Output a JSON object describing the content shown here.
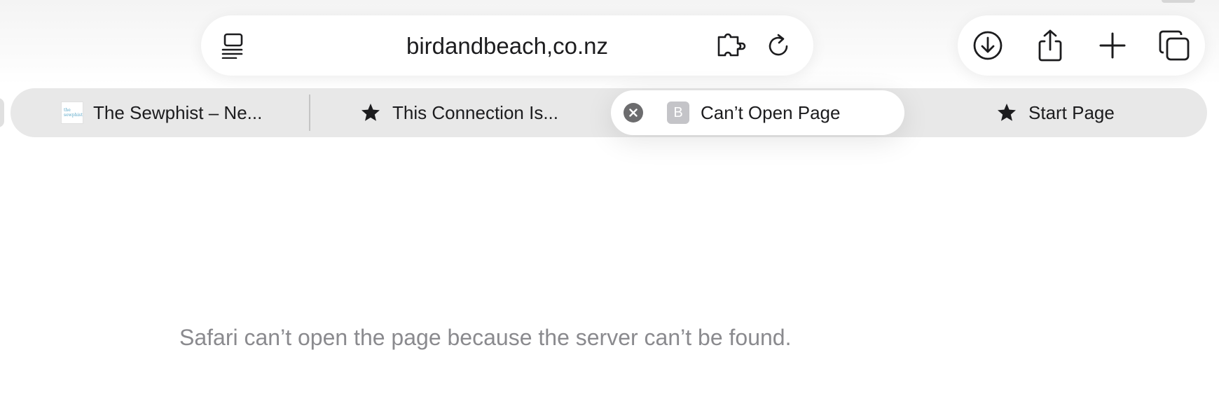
{
  "address_bar": {
    "url": "birdandbeach,co.nz",
    "icons": {
      "reader": "reader-sidebar-icon",
      "extensions": "extension-puzzle-icon",
      "reload": "reload-icon"
    }
  },
  "toolbar": {
    "icons": [
      "download-icon",
      "share-icon",
      "new-tab-plus-icon",
      "tab-overview-icon"
    ]
  },
  "tabs": [
    {
      "title": "The Sewphist – Ne...",
      "favicon": "the sewphist",
      "favicon_line1": "the",
      "favicon_line2": "sewphist",
      "active": false
    },
    {
      "title": "This Connection Is...",
      "favicon": "star-icon",
      "active": false
    },
    {
      "title": "Can’t Open Page",
      "favicon": "B",
      "active": true
    },
    {
      "title": "Start Page",
      "favicon": "star-icon",
      "active": false
    }
  ],
  "error": {
    "message": "Safari can’t open the page because the server can’t be found."
  },
  "colors": {
    "background": "#ffffff",
    "tab_strip": "#e8e8e8",
    "error_text": "#8a8a8e",
    "close_button": "#6c6c6e"
  }
}
